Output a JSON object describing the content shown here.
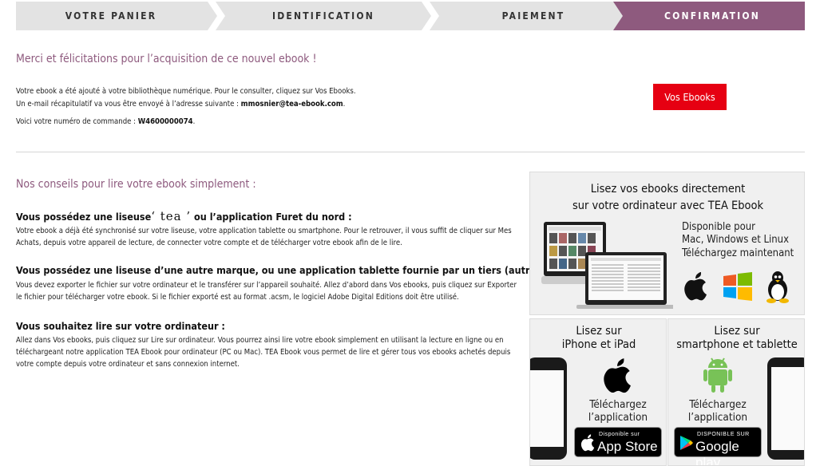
{
  "steps": [
    {
      "label": "VOTRE PANIER",
      "active": false
    },
    {
      "label": "IDENTIFICATION",
      "active": false
    },
    {
      "label": "PAIEMENT",
      "active": false
    },
    {
      "label": "CONFIRMATION",
      "active": true
    }
  ],
  "colors": {
    "accent": "#8e5a7e",
    "button_red": "#e60012",
    "link_blue": "#2a8fd1"
  },
  "confirmation": {
    "title": "Merci et félicitations pour l’acquisition de ce nouvel ebook !",
    "line1": "Votre ebook a été ajouté à votre bibliothèque numérique. Pour le consulter, cliquez sur Vos Ebooks.",
    "line2_prefix": "Un e-mail récapitulatif va vous être envoyé à l’adresse suivante : ",
    "email": "mmosnier@tea-ebook.com",
    "line2_suffix": ".",
    "order_prefix": "Voici votre numéro de commande : ",
    "order_number": "W4600000074",
    "order_suffix": ".",
    "button_label": "Vos Ebooks"
  },
  "advice": {
    "title": "Nos conseils pour lire votre ebook simplement :",
    "s1_title_a": "Vous possédez une liseuse",
    "s1_logo": "‘ tea ’",
    "s1_title_b": " ou l’application Furet du nord :",
    "s1_text": "Votre ebook a déjà été synchronisé sur votre liseuse, votre application tablette ou smartphone. Pour le retrouver, il vous suffit de cliquer sur Mes Achats, depuis votre appareil de lecture, de connecter votre compte et de télécharger votre ebook afin de le lire.",
    "s2_title": "Vous possédez une liseuse d’une autre marque, ou une application tablette fournie par un tiers (autre que Furet du nord) :",
    "s2_text": "Vous devez exporter le fichier sur votre ordinateur et le transférer sur l’appareil souhaité. Allez d’abord dans Vos ebooks, puis cliquez sur Exporter le fichier pour télécharger votre ebook. Si le fichier exporté est au format .acsm, le logiciel Adobe Digital Editions doit être utilisé.",
    "s3_title": "Vous souhaitez lire sur votre ordinateur :",
    "s3_text": "Allez dans Vos ebooks, puis cliquez sur Lire sur ordinateur. Vous pourrez ainsi lire votre ebook simplement en utilisant la lecture en ligne ou en téléchargeant notre application TEA Ebook pour ordinateur (PC ou Mac). TEA Ebook vous permet de lire et gérer tous vos ebooks achetés depuis votre compte depuis votre ordinateur et sans connexion internet."
  },
  "promo_desktop": {
    "title_line1": "Lisez vos ebooks directement",
    "title_line2": "sur votre ordinateur avec TEA Ebook",
    "available_line1": "Disponible pour",
    "available_line2": "Mac, Windows et Linux",
    "download": "Téléchargez maintenant",
    "icons": [
      "apple-icon",
      "windows-icon",
      "linux-icon"
    ]
  },
  "promo_ios": {
    "title_line1": "Lisez sur",
    "title_line2": "iPhone et iPad",
    "download_line1": "Téléchargez",
    "download_line2": "l’application",
    "badge_small": "Disponible sur",
    "badge_big": "App Store"
  },
  "promo_android": {
    "title_line1": "Lisez sur",
    "title_line2": "smartphone et tablette",
    "download_line1": "Téléchargez",
    "download_line2": "l’application",
    "badge_small": "DISPONIBLE SUR",
    "badge_big": "Google play"
  }
}
